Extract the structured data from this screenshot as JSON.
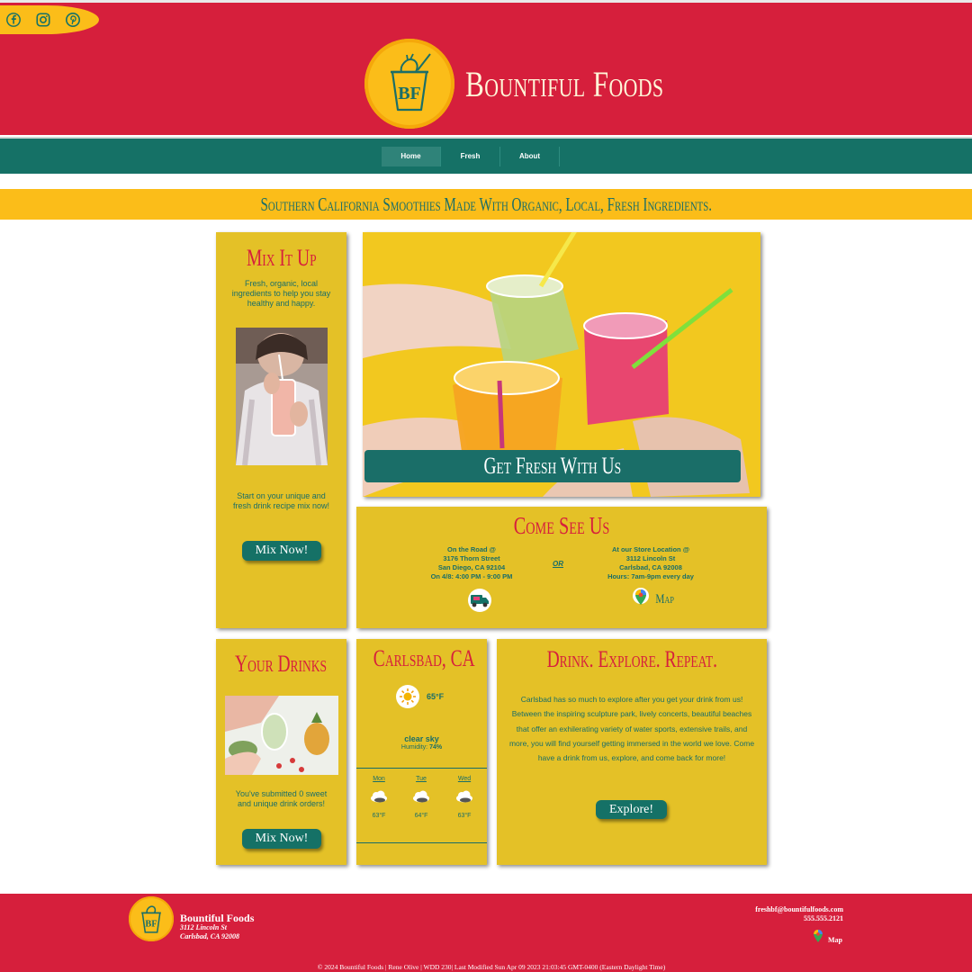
{
  "header": {
    "brand_name": "Bountiful Foods",
    "logo_initials": "BF",
    "social": [
      "facebook-icon",
      "instagram-icon",
      "pinterest-icon"
    ]
  },
  "nav": {
    "items": [
      "Home",
      "Fresh",
      "About"
    ],
    "active": "Home"
  },
  "tagline": "Southern California Smoothies Made With Organic, Local, Fresh Ingredients.",
  "mix_card": {
    "title": "Mix It Up",
    "intro": "Fresh, organic, local ingredients to help you stay healthy and happy.",
    "prompt": "Start on your unique and fresh drink recipe mix now!",
    "button": "Mix Now!"
  },
  "hero": {
    "banner": "Get Fresh With Us"
  },
  "visit_card": {
    "title": "Come See Us",
    "truck": {
      "line1": "On the Road @",
      "line2": "3176 Thorn Street",
      "line3": "San Diego, CA 92104",
      "line4": "On 4/8: 4:00 PM - 9:00 PM"
    },
    "or_label": "OR",
    "store": {
      "line1": "At our Store Location @",
      "line2": "3112 Lincoln St",
      "line3": "Carlsbad, CA 92008",
      "line4": "Hours: 7am-9pm every day"
    },
    "map_label": "Map"
  },
  "drinks_card": {
    "title": "Your Drinks",
    "count_text": "You've submitted 0 sweet and unique drink orders!",
    "button": "Mix Now!"
  },
  "weather": {
    "title": "Carlsbad, CA",
    "temp": "65°F",
    "condition": "clear sky",
    "humidity_label": "Humidity:",
    "humidity_value": "74%",
    "forecast": [
      {
        "day": "Mon",
        "temp": "63°F"
      },
      {
        "day": "Tue",
        "temp": "64°F"
      },
      {
        "day": "Wed",
        "temp": "63°F"
      }
    ]
  },
  "explore_card": {
    "title": "Drink. Explore. Repeat.",
    "body": "Carlsbad has so much to explore after you get your drink from us! Between the inspiring sculpture park, lively concerts, beautiful beaches that offer an exhilerating variety of water sports, extensive trails, and more, you will find yourself getting immersed in the world we love. Come have a drink from us, explore, and come back for more!",
    "button": "Explore!"
  },
  "footer": {
    "name": "Bountiful Foods",
    "address1": "3112 Lincoln St",
    "address2": "Carlsbad, CA 92008",
    "email": "freshbf@bountifulfoods.com",
    "phone": "555.555.2121",
    "map_label": "Map",
    "copyright": "© 2024 Bountiful Foods | Rene Olive | WDD 230| Last Modified Sun Apr 09 2023 21:03:45 GMT-0400 (Eastern Daylight Time)"
  },
  "colors": {
    "red": "#d61f3c",
    "teal": "#157166",
    "yellow": "#fbbd19",
    "card": "#e4c127"
  }
}
